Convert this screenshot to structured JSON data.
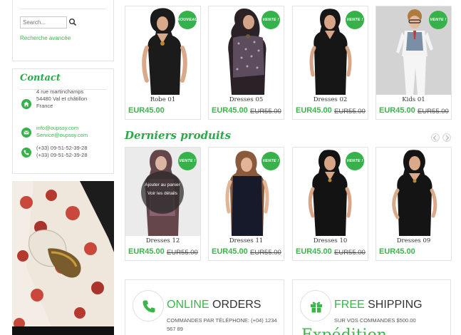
{
  "search": {
    "placeholder": "Search...",
    "advanced_link": "Recherche avancée"
  },
  "contact": {
    "title": "Contact",
    "address": [
      "4 rue martinchamps",
      "54480 Val et châtillon",
      "France"
    ],
    "emails": [
      "info@oupssy.com",
      "Service@oupssy.com"
    ],
    "phones": [
      "(+33) 09-51-52-39-28",
      "(+33) 09-51-52-39-28"
    ]
  },
  "sections": {
    "latest": "Derniers produits"
  },
  "products_top": [
    {
      "name": "Robe 01",
      "price": "EUR45.00",
      "old_price": "",
      "badge": "NOUVEAU"
    },
    {
      "name": "Dresses 05",
      "price": "EUR45.00",
      "old_price": "EUR55.00",
      "badge": "VENTE !"
    },
    {
      "name": "Dresses 02",
      "price": "EUR45.00",
      "old_price": "EUR55.00",
      "badge": "VENTE !"
    },
    {
      "name": "Kids 01",
      "price": "EUR45.00",
      "old_price": "EUR55.00",
      "badge": "VENTE !"
    }
  ],
  "products_latest": [
    {
      "name": "Dresses 12",
      "price": "EUR45.00",
      "old_price": "EUR55.00",
      "badge": "VENTE !"
    },
    {
      "name": "Dresses 11",
      "price": "EUR45.00",
      "old_price": "EUR55.00",
      "badge": "VENTE !"
    },
    {
      "name": "Dresses 10",
      "price": "EUR45.00",
      "old_price": "EUR55.00",
      "badge": "VENTE !"
    },
    {
      "name": "Dresses 09",
      "price": "EUR45.00",
      "old_price": "",
      "badge": ""
    }
  ],
  "hover": {
    "add_to_cart": "Ajouter au panier",
    "view_details": "Voir les détails"
  },
  "features": [
    {
      "title_highlight": "ONLINE",
      "title_rest": " ORDERS",
      "subtitle": "COMMANDES PAR TÉLÉPHONE: (+04) 1234 567 89",
      "icon": "phone-icon"
    },
    {
      "title_highlight": "FREE",
      "title_rest": " SHIPPING",
      "subtitle": "SUR VOS COMMANDES $500.00",
      "icon": "gift-icon"
    }
  ],
  "partial_heading": "Expédition",
  "colors": {
    "accent": "#37b24a",
    "border": "#e3e3e3"
  }
}
